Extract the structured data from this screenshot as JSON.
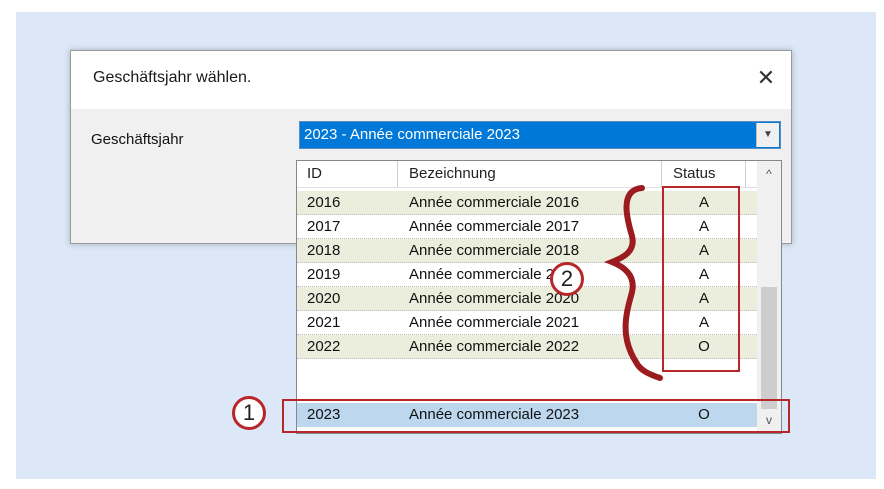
{
  "dialog": {
    "title": "Geschäftsjahr wählen.",
    "close_glyph": "✕",
    "field_label": "Geschäftsjahr",
    "combo_value": "2023 - Année commerciale 2023",
    "combo_arrow": "▼"
  },
  "dropdown": {
    "columns": {
      "id": "ID",
      "name": "Bezeichnung",
      "status": "Status"
    },
    "rows": [
      {
        "id": "2016",
        "name": "Année commerciale 2016",
        "status": "A"
      },
      {
        "id": "2017",
        "name": "Année commerciale 2017",
        "status": "A"
      },
      {
        "id": "2018",
        "name": "Année commerciale 2018",
        "status": "A"
      },
      {
        "id": "2019",
        "name": "Année commerciale 2019",
        "status": "A"
      },
      {
        "id": "2020",
        "name": "Année commerciale 2020",
        "status": "A"
      },
      {
        "id": "2021",
        "name": "Année commerciale 2021",
        "status": "A"
      },
      {
        "id": "2022",
        "name": "Année commerciale 2022",
        "status": "O"
      },
      {
        "id": "2023",
        "name": "Année commerciale 2023",
        "status": "O"
      }
    ],
    "selected_index": 7,
    "scroll_up": "^",
    "scroll_down": "v"
  },
  "annotations": {
    "marker_1": "1",
    "marker_2": "2",
    "color": "#b8262a"
  },
  "icons": [
    "close-icon",
    "chevron-down-icon",
    "scroll-up-icon",
    "scroll-down-icon"
  ]
}
